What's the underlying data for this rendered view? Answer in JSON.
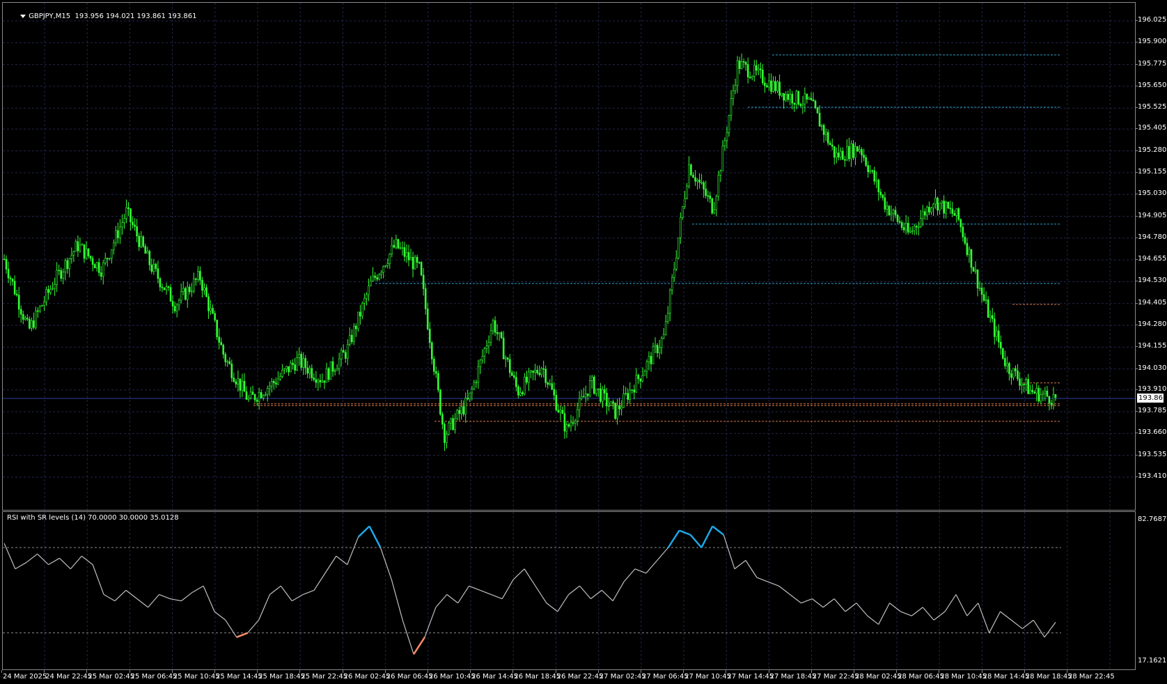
{
  "symbol_header": {
    "symbol": "GBPJPY,M15",
    "ohlc": "193.956 194.021 193.861 193.861"
  },
  "rsi_header": {
    "text": "RSI with SR levels (14) 70.0000 30.0000 35.0128"
  },
  "current_price_tag": "193.861",
  "price_axis_labels": [
    "196.025",
    "195.900",
    "195.775",
    "195.650",
    "195.525",
    "195.405",
    "195.280",
    "195.155",
    "195.030",
    "194.905",
    "194.780",
    "194.655",
    "194.530",
    "194.405",
    "194.280",
    "194.155",
    "194.030",
    "193.910",
    "193.785",
    "193.660",
    "193.535",
    "193.410"
  ],
  "rsi_axis_labels": [
    "82.7687",
    "17.1621"
  ],
  "time_axis_labels": [
    "24 Mar 2025",
    "24 Mar 22:45",
    "25 Mar 02:45",
    "25 Mar 06:45",
    "25 Mar 10:45",
    "25 Mar 14:45",
    "25 Mar 18:45",
    "25 Mar 22:45",
    "26 Mar 02:45",
    "26 Mar 06:45",
    "26 Mar 10:45",
    "26 Mar 14:45",
    "26 Mar 18:45",
    "26 Mar 22:45",
    "27 Mar 02:45",
    "27 Mar 06:45",
    "27 Mar 10:45",
    "27 Mar 14:45",
    "27 Mar 18:45",
    "27 Mar 22:45",
    "28 Mar 02:45",
    "28 Mar 06:45",
    "28 Mar 10:45",
    "28 Mar 14:45",
    "28 Mar 18:45",
    "28 Mar 22:45"
  ],
  "colors": {
    "candle": "#33ff33",
    "grid": "#22264d",
    "resistance": "#2aa0c8",
    "support": "#d87a4a",
    "rsi_line": "#c0c0c0",
    "rsi_overbought": "#1ea7e6",
    "rsi_oversold": "#ff8c69",
    "current_price_line": "#3040a0"
  },
  "chart_data": [
    {
      "type": "candlestick",
      "title": "GBPJPY,M15",
      "ylim": [
        193.41,
        196.025
      ],
      "x": [
        "24 Mar 2025",
        "24 Mar 22:45",
        "25 Mar 02:45",
        "25 Mar 06:45",
        "25 Mar 10:45",
        "25 Mar 14:45",
        "25 Mar 18:45",
        "25 Mar 22:45",
        "26 Mar 02:45",
        "26 Mar 06:45",
        "26 Mar 10:45",
        "26 Mar 14:45",
        "26 Mar 18:45",
        "26 Mar 22:45",
        "27 Mar 02:45",
        "27 Mar 06:45",
        "27 Mar 10:45",
        "27 Mar 14:45",
        "27 Mar 18:45",
        "27 Mar 22:45",
        "28 Mar 02:45",
        "28 Mar 06:45",
        "28 Mar 10:45",
        "28 Mar 14:45",
        "28 Mar 18:45",
        "28 Mar 22:45"
      ],
      "close_path": [
        194.66,
        194.25,
        194.52,
        194.74,
        194.6,
        194.93,
        194.62,
        194.4,
        194.56,
        194.1,
        193.85,
        193.95,
        194.08,
        193.97,
        194.13,
        194.52,
        194.74,
        194.6,
        193.65,
        193.85,
        194.3,
        193.9,
        194.05,
        193.68,
        193.95,
        193.78,
        193.99,
        194.22,
        195.2,
        194.95,
        195.78,
        195.7,
        195.6,
        195.55,
        195.25,
        195.3,
        194.98,
        194.8,
        195.0,
        194.9,
        194.45,
        194.05,
        193.9,
        193.861
      ],
      "current_price": 193.861,
      "resistance_levels": [
        195.83,
        195.53,
        194.86,
        194.52
      ],
      "support_levels": [
        194.4,
        193.95,
        193.83,
        193.82,
        193.73
      ]
    },
    {
      "type": "line",
      "title": "RSI with SR levels (14) 70.0000 30.0000 35.0128",
      "ylim": [
        17.1621,
        82.7687
      ],
      "levels": [
        70,
        30
      ],
      "current_value": 35.0128,
      "values": [
        72,
        60,
        63,
        67,
        62,
        65,
        60,
        66,
        62,
        48,
        45,
        50,
        46,
        42,
        48,
        46,
        45,
        49,
        52,
        40,
        36,
        28,
        30,
        36,
        48,
        52,
        45,
        48,
        50,
        58,
        66,
        62,
        75,
        80,
        70,
        55,
        36,
        20,
        28,
        42,
        48,
        44,
        52,
        50,
        48,
        46,
        55,
        60,
        52,
        44,
        40,
        48,
        52,
        46,
        50,
        45,
        54,
        60,
        58,
        64,
        70,
        78,
        76,
        70,
        80,
        76,
        60,
        64,
        56,
        54,
        52,
        48,
        44,
        46,
        42,
        46,
        40,
        44,
        38,
        34,
        44,
        40,
        38,
        42,
        36,
        40,
        48,
        38,
        44,
        30,
        40,
        36,
        32,
        36,
        28,
        35
      ]
    }
  ]
}
